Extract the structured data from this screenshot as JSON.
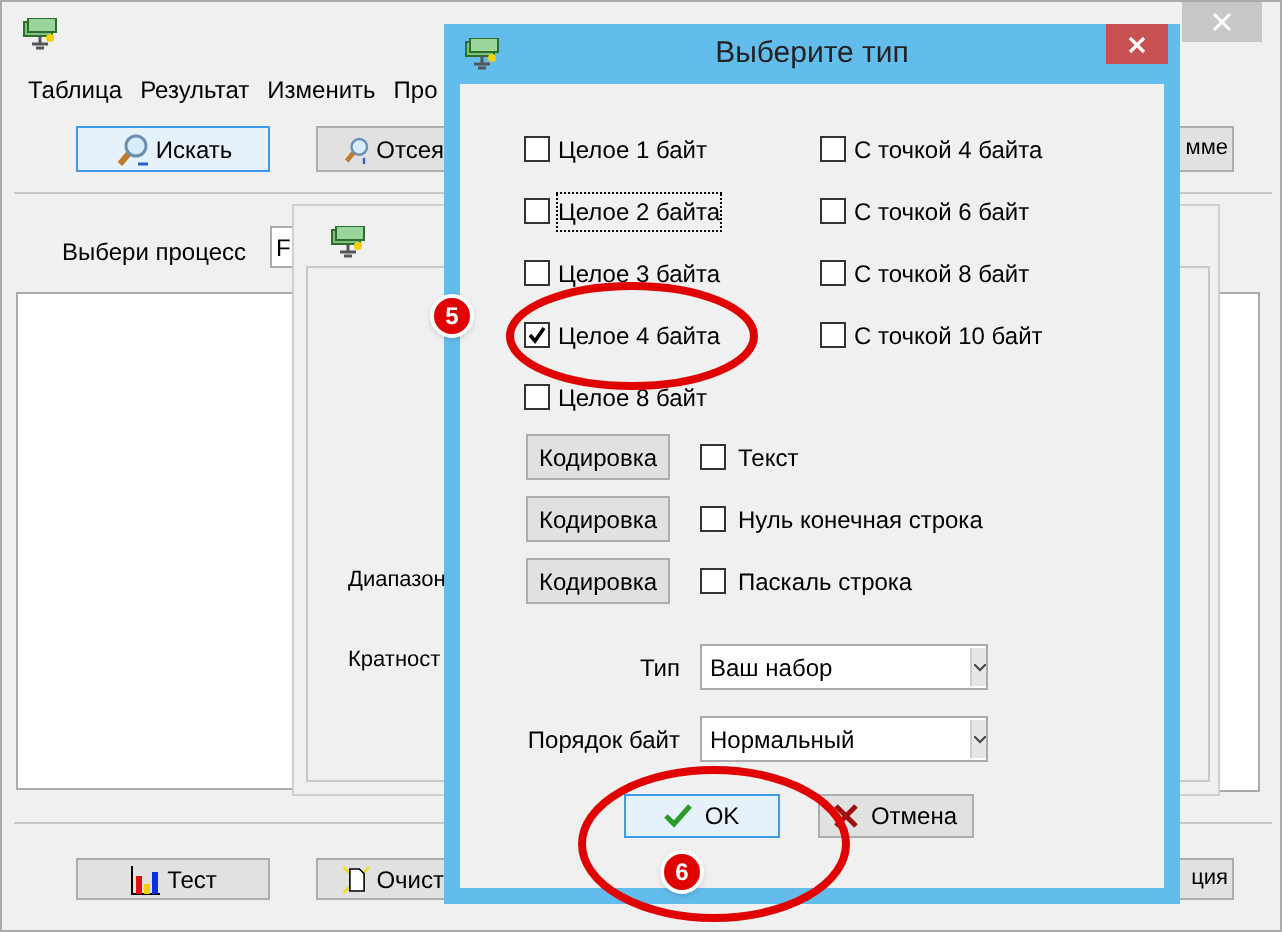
{
  "main_window": {
    "menu": [
      {
        "label": "Таблица"
      },
      {
        "label": "Результат"
      },
      {
        "label": "Изменить"
      },
      {
        "label": "Про"
      }
    ],
    "toolbar": [
      {
        "label": "Искать",
        "selected": true,
        "kind": "search"
      },
      {
        "label": "Отсея",
        "selected": false,
        "kind": "filter"
      },
      {
        "label": "мме",
        "selected": false,
        "kind": "plain"
      }
    ],
    "process_label": "Выбери процесс",
    "process_value": "F",
    "bottom_buttons": [
      {
        "label": "Тест",
        "kind": "chart"
      },
      {
        "label": "Очист",
        "kind": "clear"
      },
      {
        "label": "ция",
        "kind": "plain"
      }
    ]
  },
  "back_dialog": {
    "labels": [
      "Диапазон",
      "Кратност"
    ]
  },
  "dialog": {
    "title": "Выберите тип",
    "columns": [
      [
        {
          "label": "Целое 1 байт",
          "checked": false,
          "focused": false
        },
        {
          "label": "Целое 2 байта",
          "checked": false,
          "focused": true
        },
        {
          "label": "Целое 3 байта",
          "checked": false,
          "focused": false
        },
        {
          "label": "Целое 4 байта",
          "checked": true,
          "focused": false
        },
        {
          "label": "Целое 8 байт",
          "checked": false,
          "focused": false
        }
      ],
      [
        {
          "label": "С точкой 4 байта",
          "checked": false,
          "focused": false
        },
        {
          "label": "С точкой 6 байт",
          "checked": false,
          "focused": false
        },
        {
          "label": "С точкой 8 байт",
          "checked": false,
          "focused": false
        },
        {
          "label": "С точкой 10 байт",
          "checked": false,
          "focused": false
        }
      ]
    ],
    "encodings": [
      {
        "button": "Кодировка",
        "label": "Текст",
        "checked": false
      },
      {
        "button": "Кодировка",
        "label": "Нуль конечная строка",
        "checked": false
      },
      {
        "button": "Кодировка",
        "label": "Паскаль строка",
        "checked": false
      }
    ],
    "type_label": "Тип",
    "type_value": "Ваш набор",
    "order_label": "Порядок байт",
    "order_value": "Нормальный",
    "ok": "OK",
    "cancel": "Отмена"
  },
  "annotations": [
    {
      "number": "5"
    },
    {
      "number": "6"
    }
  ]
}
